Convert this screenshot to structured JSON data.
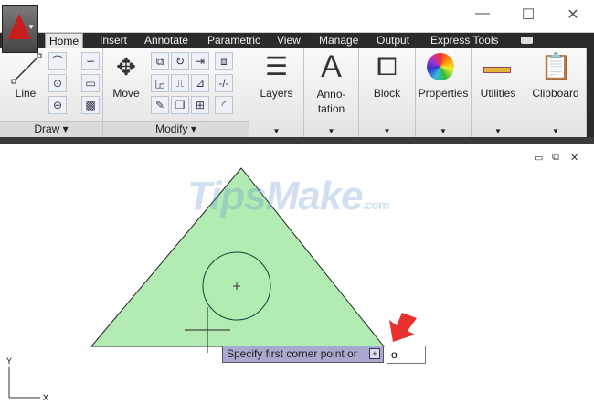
{
  "window": {
    "minimize": "—",
    "maximize": "☐",
    "close": "✕"
  },
  "tabs": [
    "Home",
    "Insert",
    "Annotate",
    "Parametric",
    "View",
    "Manage",
    "Output",
    "Express Tools"
  ],
  "panels": {
    "draw": {
      "label": "Draw ▾",
      "line": "Line"
    },
    "modify": {
      "label": "Modify ▾",
      "move": "Move"
    },
    "layers": "Layers",
    "annotation": "Anno-\ntation",
    "block": "Block",
    "properties": "Properties",
    "utilities": "Utilities",
    "clipboard": "Clipboard"
  },
  "canvas": {
    "watermark": "TipsMake",
    "watermark_suffix": ".com",
    "tooltip": "Specify first corner point or",
    "command_value": "o",
    "ucs_x": "X",
    "ucs_y": "Y"
  },
  "colors": {
    "fill": "#b2ecb2",
    "accent": "#e83030"
  }
}
